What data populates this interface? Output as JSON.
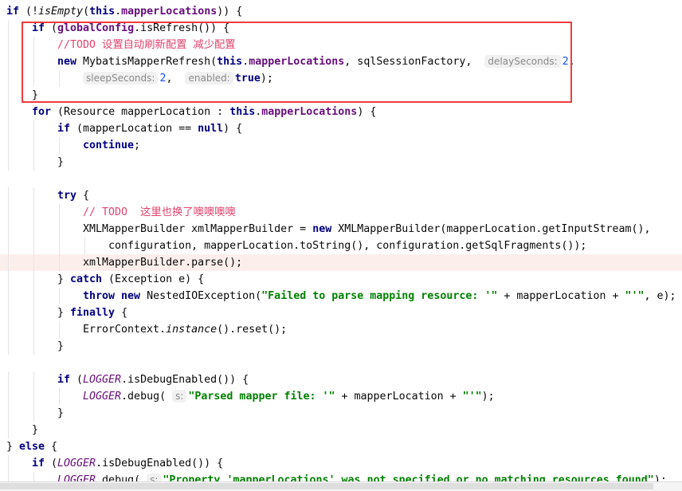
{
  "colors": {
    "highlight_box": "#f03c3c",
    "current_line": "#fcefeb",
    "keyword": "#000080",
    "field": "#660e7a",
    "string": "#008000",
    "number": "#1750eb",
    "todo_comment": "#e0446c"
  },
  "lines": [
    {
      "indent": 0,
      "tokens": [
        [
          "k",
          "if"
        ],
        [
          "p",
          " (!"
        ],
        [
          "m",
          "isEmpty"
        ],
        [
          "p",
          "("
        ],
        [
          "k",
          "this"
        ],
        [
          "p",
          "."
        ],
        [
          "f",
          "mapperLocations"
        ],
        [
          "p",
          ")) {"
        ]
      ]
    },
    {
      "indent": 1,
      "tokens": [
        [
          "k",
          "if"
        ],
        [
          "p",
          " ("
        ],
        [
          "f",
          "globalConfig"
        ],
        [
          "p",
          ".isRefresh()) {"
        ]
      ]
    },
    {
      "indent": 2,
      "tokens": [
        [
          "c",
          "//TODO 设置自动刷新配置 减少配置"
        ]
      ]
    },
    {
      "indent": 2,
      "tokens": [
        [
          "k",
          "new"
        ],
        [
          "p",
          " MybatisMapperRefresh("
        ],
        [
          "k",
          "this"
        ],
        [
          "p",
          "."
        ],
        [
          "f",
          "mapperLocations"
        ],
        [
          "p",
          ", sqlSessionFactory,  "
        ],
        [
          "h",
          "delaySeconds:"
        ],
        [
          "n",
          "2"
        ],
        [
          "p",
          ","
        ]
      ]
    },
    {
      "indent": 3,
      "tokens": [
        [
          "h",
          "sleepSeconds:"
        ],
        [
          "n",
          "2"
        ],
        [
          "p",
          ",  "
        ],
        [
          "h",
          "enabled:"
        ],
        [
          "k",
          "true"
        ],
        [
          "p",
          ");"
        ]
      ]
    },
    {
      "indent": 1,
      "tokens": [
        [
          "p",
          "}"
        ]
      ]
    },
    {
      "indent": 1,
      "tokens": [
        [
          "k",
          "for"
        ],
        [
          "p",
          " (Resource mapperLocation : "
        ],
        [
          "k",
          "this"
        ],
        [
          "p",
          "."
        ],
        [
          "f",
          "mapperLocations"
        ],
        [
          "p",
          ") {"
        ]
      ]
    },
    {
      "indent": 2,
      "tokens": [
        [
          "k",
          "if"
        ],
        [
          "p",
          " (mapperLocation == "
        ],
        [
          "k",
          "null"
        ],
        [
          "p",
          ") {"
        ]
      ]
    },
    {
      "indent": 3,
      "tokens": [
        [
          "k",
          "continue"
        ],
        [
          "p",
          ";"
        ]
      ]
    },
    {
      "indent": 2,
      "tokens": [
        [
          "p",
          "}"
        ]
      ]
    },
    {
      "indent": 0,
      "tokens": []
    },
    {
      "indent": 2,
      "tokens": [
        [
          "k",
          "try"
        ],
        [
          "p",
          " {"
        ]
      ]
    },
    {
      "indent": 3,
      "tokens": [
        [
          "c",
          "// TODO  这里也换了噢噢噢噢"
        ]
      ]
    },
    {
      "indent": 3,
      "tokens": [
        [
          "p",
          "XMLMapperBuilder xmlMapperBuilder = "
        ],
        [
          "k",
          "new"
        ],
        [
          "p",
          " XMLMapperBuilder(mapperLocation.getInputStream(),"
        ]
      ]
    },
    {
      "indent": 4,
      "tokens": [
        [
          "p",
          "configuration, mapperLocation.toString(), configuration.getSqlFragments());"
        ]
      ]
    },
    {
      "indent": 3,
      "current": true,
      "tokens": [
        [
          "p",
          "xmlMapperBuilder.parse();"
        ]
      ]
    },
    {
      "indent": 2,
      "tokens": [
        [
          "p",
          "} "
        ],
        [
          "k",
          "catch"
        ],
        [
          "p",
          " (Exception e) {"
        ]
      ]
    },
    {
      "indent": 3,
      "tokens": [
        [
          "k",
          "throw new"
        ],
        [
          "p",
          " NestedIOException("
        ],
        [
          "str",
          "\"Failed to parse mapping resource: '\""
        ],
        [
          "p",
          " + mapperLocation + "
        ],
        [
          "str",
          "\"'\""
        ],
        [
          "p",
          ", e);"
        ]
      ]
    },
    {
      "indent": 2,
      "tokens": [
        [
          "p",
          "} "
        ],
        [
          "k",
          "finally"
        ],
        [
          "p",
          " {"
        ]
      ]
    },
    {
      "indent": 3,
      "tokens": [
        [
          "p",
          "ErrorContext."
        ],
        [
          "m",
          "instance"
        ],
        [
          "p",
          "().reset();"
        ]
      ]
    },
    {
      "indent": 2,
      "tokens": [
        [
          "p",
          "}"
        ]
      ]
    },
    {
      "indent": 0,
      "tokens": []
    },
    {
      "indent": 2,
      "tokens": [
        [
          "k",
          "if"
        ],
        [
          "p",
          " ("
        ],
        [
          "s",
          "LOGGER"
        ],
        [
          "p",
          ".isDebugEnabled()) {"
        ]
      ]
    },
    {
      "indent": 3,
      "tokens": [
        [
          "s",
          "LOGGER"
        ],
        [
          "p",
          ".debug( "
        ],
        [
          "h",
          "s:"
        ],
        [
          "str",
          "\"Parsed mapper file: '\""
        ],
        [
          "p",
          " + mapperLocation + "
        ],
        [
          "str",
          "\"'\""
        ],
        [
          "p",
          ");"
        ]
      ]
    },
    {
      "indent": 2,
      "tokens": [
        [
          "p",
          "}"
        ]
      ]
    },
    {
      "indent": 1,
      "tokens": [
        [
          "p",
          "}"
        ]
      ]
    },
    {
      "indent": 0,
      "tokens": [
        [
          "p",
          "} "
        ],
        [
          "k",
          "else"
        ],
        [
          "p",
          " {"
        ]
      ]
    },
    {
      "indent": 1,
      "tokens": [
        [
          "k",
          "if"
        ],
        [
          "p",
          " ("
        ],
        [
          "s",
          "LOGGER"
        ],
        [
          "p",
          ".isDebugEnabled()) {"
        ]
      ]
    },
    {
      "indent": 2,
      "tokens": [
        [
          "s",
          "LOGGER"
        ],
        [
          "p",
          ".debug( "
        ],
        [
          "h",
          "s:"
        ],
        [
          "str",
          "\"Property 'mapperLocations' was not specified or no matching resources found\""
        ],
        [
          "p",
          ");"
        ]
      ]
    }
  ]
}
